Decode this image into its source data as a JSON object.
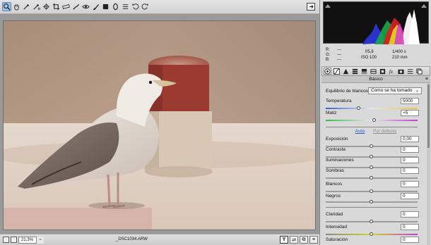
{
  "toolbar": {
    "tools": [
      "zoom-icon",
      "hand-icon",
      "white-balance-icon",
      "color-sampler-icon",
      "targeted-adjustment-icon",
      "crop-icon",
      "straighten-icon",
      "spot-removal-icon",
      "red-eye-icon",
      "adjustment-brush-icon",
      "graduated-filter-icon",
      "radial-filter-icon",
      "preferences-icon",
      "rotate-left-icon",
      "rotate-right-icon"
    ],
    "active_tool": "zoom-icon"
  },
  "status": {
    "zoom": "21,3%",
    "filename": "_DSC1034.ARW"
  },
  "info": {
    "r_label": "R:",
    "g_label": "G:",
    "b_label": "B:",
    "r_value": "---",
    "g_value": "---",
    "b_value": "---",
    "aperture": "f/5,6",
    "shutter": "1/400 s",
    "iso": "ISO 100",
    "focal": "210 mm"
  },
  "panel": {
    "section_title": "Básico",
    "wb_label": "Equilibrio de blancos:",
    "wb_value": "Como se ha tomado",
    "auto_label": "Auto",
    "default_label": "Por defecto",
    "sliders": [
      {
        "key": "temperature",
        "label": "Temperatura",
        "value": "5000",
        "pos": 0.36
      },
      {
        "key": "tint",
        "label": "Matiz",
        "value": "+5",
        "pos": 0.53
      },
      {
        "key": "exposure",
        "label": "Exposición",
        "value": "0,00",
        "pos": 0.5
      },
      {
        "key": "contrast",
        "label": "Contraste",
        "value": "0",
        "pos": 0.5
      },
      {
        "key": "highlights",
        "label": "Iluminaciones",
        "value": "0",
        "pos": 0.5
      },
      {
        "key": "shadows",
        "label": "Sombras",
        "value": "0",
        "pos": 0.5
      },
      {
        "key": "whites",
        "label": "Blancos",
        "value": "0",
        "pos": 0.5
      },
      {
        "key": "blacks",
        "label": "Negros",
        "value": "0",
        "pos": 0.5
      },
      {
        "key": "clarity",
        "label": "Claridad",
        "value": "0",
        "pos": 0.5
      },
      {
        "key": "vibrance",
        "label": "Intensidad",
        "value": "0",
        "pos": 0.5
      },
      {
        "key": "saturation",
        "label": "Saturación",
        "value": "0",
        "pos": 0.5
      }
    ]
  },
  "colors": {
    "panel_bg": "#d9d9d9",
    "accent": "#1a5fc9",
    "histogram_bg": "#111111"
  }
}
